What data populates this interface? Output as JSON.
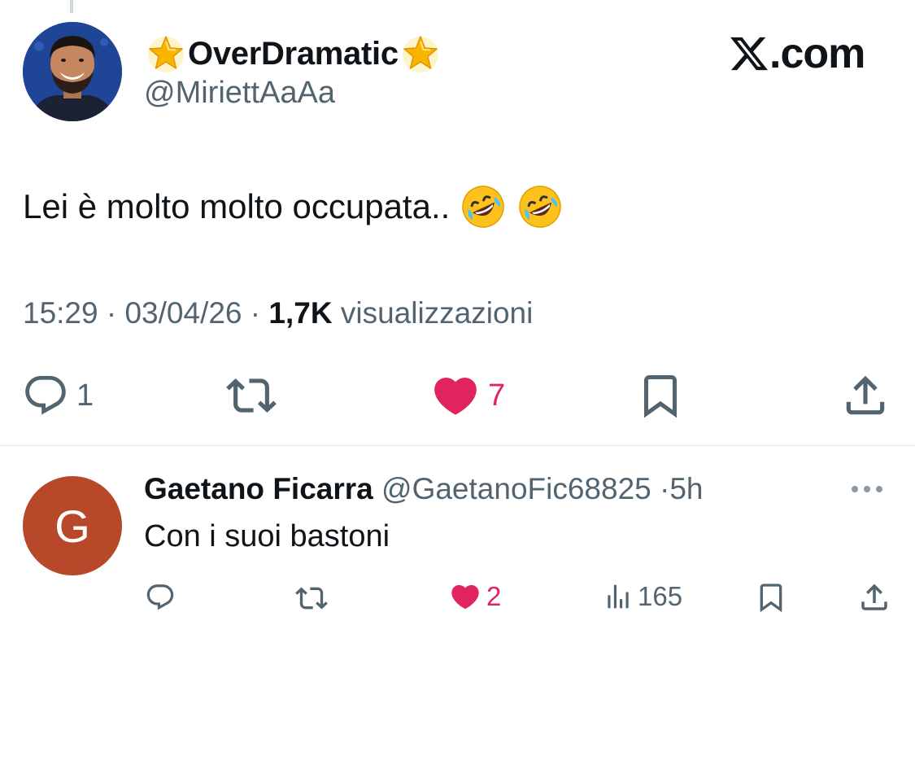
{
  "tweet": {
    "display_name": "OverDramatic",
    "handle": "@MiriettAaAa",
    "brand": ".com",
    "text": "Lei è molto molto occupata..",
    "emoji": [
      "rolling-on-floor-laughing",
      "rolling-on-floor-laughing"
    ],
    "time": "15:29",
    "date": "03/04/26",
    "views_count": "1,7K",
    "views_label": "visualizzazioni",
    "reply_count": "1",
    "like_count": "7",
    "liked": true
  },
  "reply": {
    "avatar_letter": "G",
    "display_name": "Gaetano Ficarra",
    "handle": "@GaetanoFic68825",
    "age": "5h",
    "text": "Con i suoi bastoni",
    "like_count": "2",
    "views": "165",
    "liked": true
  },
  "colors": {
    "text": "#0f1419",
    "secondary": "#536471",
    "like": "#e0245e",
    "reply_avatar_bg": "#b7482a",
    "divider": "#e1e6ea"
  }
}
